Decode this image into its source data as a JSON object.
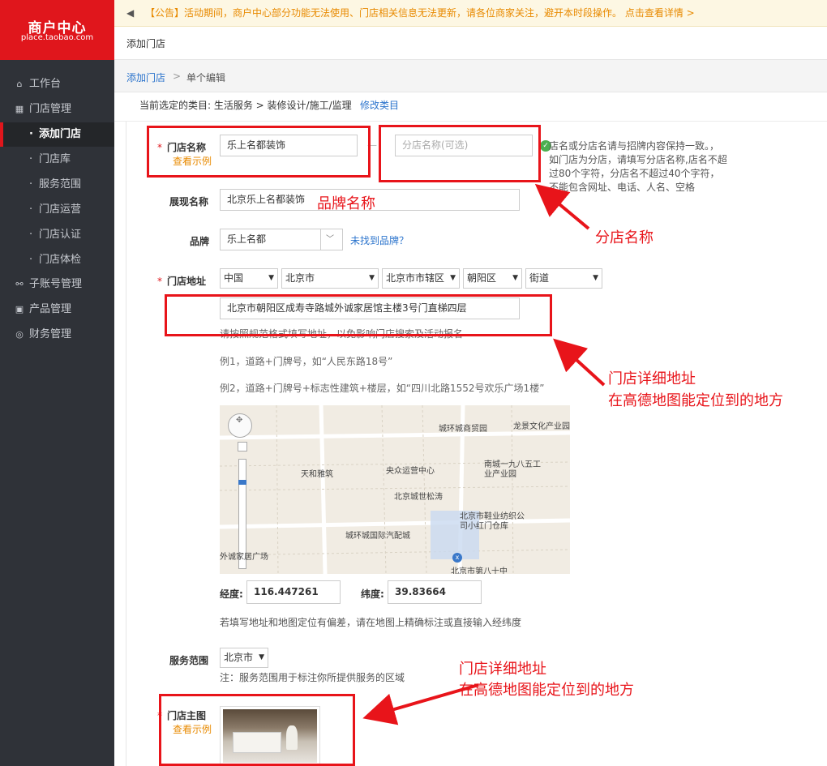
{
  "sidebar": {
    "logo_title": "商户中心",
    "logo_sub": "place.taobao.com",
    "items": [
      {
        "label": "工作台",
        "icon": "⌂"
      },
      {
        "label": "门店管理",
        "icon": "▦"
      },
      {
        "label": "添加门店",
        "sub": true,
        "active": true
      },
      {
        "label": "门店库",
        "sub": true
      },
      {
        "label": "服务范围",
        "sub": true
      },
      {
        "label": "门店运营",
        "sub": true
      },
      {
        "label": "门店认证",
        "sub": true
      },
      {
        "label": "门店体检",
        "sub": true
      },
      {
        "label": "子账号管理",
        "icon": "⚯"
      },
      {
        "label": "产品管理",
        "icon": "▣"
      },
      {
        "label": "财务管理",
        "icon": "◎"
      }
    ],
    "sub_dot": "·"
  },
  "notice": {
    "icon": "◀",
    "text": "【公告】活动期间，商户中心部分功能无法使用、门店相关信息无法更新，请各位商家关注，避开本时段操作。 点击查看详情 >"
  },
  "page_title": "添加门店",
  "breadcrumb": {
    "parent": "添加门店",
    "sep": ">",
    "current": "单个编辑"
  },
  "category": {
    "prefix": "当前选定的类目: 生活服务 > 装修设计/施工/监理",
    "edit": "修改类目"
  },
  "form": {
    "req": "*",
    "name_label": "门店名称",
    "example": "查看示例",
    "name_value": "乐上名都装饰",
    "dash": "—",
    "branch_placeholder": "分店名称(可选)",
    "tip": "店名或分店名请与招牌内容保持一致。，如门店为分店，请填写分店名称,店名不超过80个字符，分店名不超过40个字符，不能包含网址、电话、人名、空格",
    "display_label": "展现名称",
    "display_value": "北京乐上名都装饰",
    "brand_label": "品牌",
    "brand_value": "乐上名都",
    "brand_link": "未找到品牌？",
    "addr_label": "门店地址",
    "country": "中国",
    "province": "北京市",
    "city": "北京市市辖区",
    "district": "朝阳区",
    "street": "街道",
    "addr_value": "北京市朝阳区成寿寺路城外诚家居馆主楼3号门直梯四层",
    "addr_hint": "请按照规范格式填写地址，以免影响门店搜索及活动报名",
    "ex1": "例1，道路+门牌号，如“人民东路18号”",
    "ex2": "例2，道路+门牌号+标志性建筑+楼层，如“四川北路1552号欢乐广场1楼”",
    "lng_label": "经度:",
    "lng_value": "116.447261",
    "lat_label": "纬度:",
    "lat_value": "39.83664",
    "map_hint": "若填写地址和地图定位有偏差，请在地图上精确标注或直接输入经纬度",
    "scope_label": "服务范围",
    "scope_value": "北京市",
    "scope_note": "注：服务范围用于标注你所提供服务的区域",
    "photo_label": "门店主图"
  },
  "map": {
    "labels": [
      "城环城商贸园",
      "龙景文化产业园",
      "天和雅筑",
      "央众运营中心",
      "南城一九八五工业产业园",
      "北京城世松涛",
      "北京市鞋业纺织公司小红门仓库",
      "城环城国际汽配城",
      "北京市第八十中",
      "城外诚家居广场"
    ],
    "pin": "x"
  },
  "annotations": {
    "brand": "品牌名称",
    "branch": "分店名称",
    "addr1": "门店详细地址",
    "addr2": "在高德地图能定位到的地方",
    "bottom1": "门店详细地址",
    "bottom2": "在高德地图能定位到的地方"
  },
  "colors": {
    "accent": "#e0161c",
    "sidebar": "#2f3238",
    "link": "#2a73cc",
    "annotation": "#e8141a"
  }
}
